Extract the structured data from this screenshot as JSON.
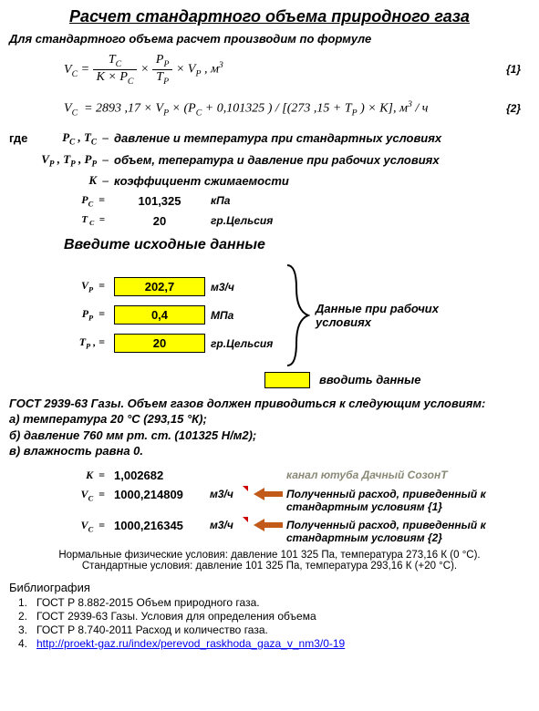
{
  "title": "Расчет  стандартного объема природного газа",
  "subtitle": "Для стандартного объема расчет производим по формуле",
  "formulas": {
    "f1": {
      "num": "{1}"
    },
    "f2": {
      "text": "V_C  = 2893 ,17 × V_P × (P_C + 0,101325 ) / [(273 ,15 + T_P ) × K], м³ / ч",
      "num": "{2}"
    }
  },
  "defs": {
    "where": "где",
    "d1_sym": "P_C , T_C  –",
    "d1": "давление и температура при стандартных условиях",
    "d2_sym": "V_P , T_P , P_P  –",
    "d2": "объем, тепература и давление при рабочих условиях",
    "d3_sym": "K  –",
    "d3": "коэффициент сжимаемости",
    "pc_sym": "P_C  =",
    "pc_val": "101,325",
    "pc_unit": "кПа",
    "tc_sym": "T _C   =",
    "tc_val": "20",
    "tc_unit": "гр.Цельсия"
  },
  "input_header": "Введите исходные данные",
  "inputs": {
    "vp_sym": "V_P  =",
    "vp_val": "202,7",
    "vp_unit": "м3/ч",
    "pp_sym": "P_P  =",
    "pp_val": "0,4",
    "pp_unit": "МПа",
    "tp_sym": "T_P , =",
    "tp_val": "20",
    "tp_unit": "гр.Цельсия"
  },
  "bracket_label": "Данные при рабочих условиях",
  "legend": "вводить данные",
  "gost": {
    "l1": "ГОСТ 2939-63 Газы. Объем газов должен приводиться к следующим условиям:",
    "l2": "а) температура 20 °С (293,15 °К);",
    "l3": "б) давление 760 мм рт. ст. (101325 Н/м2);",
    "l4": "в) влажность равна 0."
  },
  "results": {
    "k_sym": "K  =",
    "k_val": "1,002682",
    "channel": "канал ютуба Дачный СозонТ",
    "vc1_sym": "V_C  =",
    "vc1_val": "1000,214809",
    "vc1_unit": "м3/ч",
    "vc1_desc": "Полученный расход, приведенный к стандартным условиям {1}",
    "vc2_sym": "V_C  =",
    "vc2_val": "1000,216345",
    "vc2_unit": "м3/ч",
    "vc2_desc": "Полученный расход, приведенный к стандартным условиям {2}"
  },
  "notes": {
    "n1": "Нормальные физические условия: давление 101 325 Па, температура 273,16 К (0 °С).",
    "n2": "Стандартные условия: давление 101 325 Па, температура 293,16 К (+20 °С)."
  },
  "bib": {
    "head": "Библиография",
    "items": [
      "ГОСТ Р 8.882-2015 Объем природного газа.",
      "ГОСТ 2939-63 Газы. Условия для определения объема",
      "ГОСТ Р 8.740-2011   Расход и количество газа.",
      "http://proekt-gaz.ru/index/perevod_raskhoda_gaza_v_nm3/0-19"
    ]
  }
}
